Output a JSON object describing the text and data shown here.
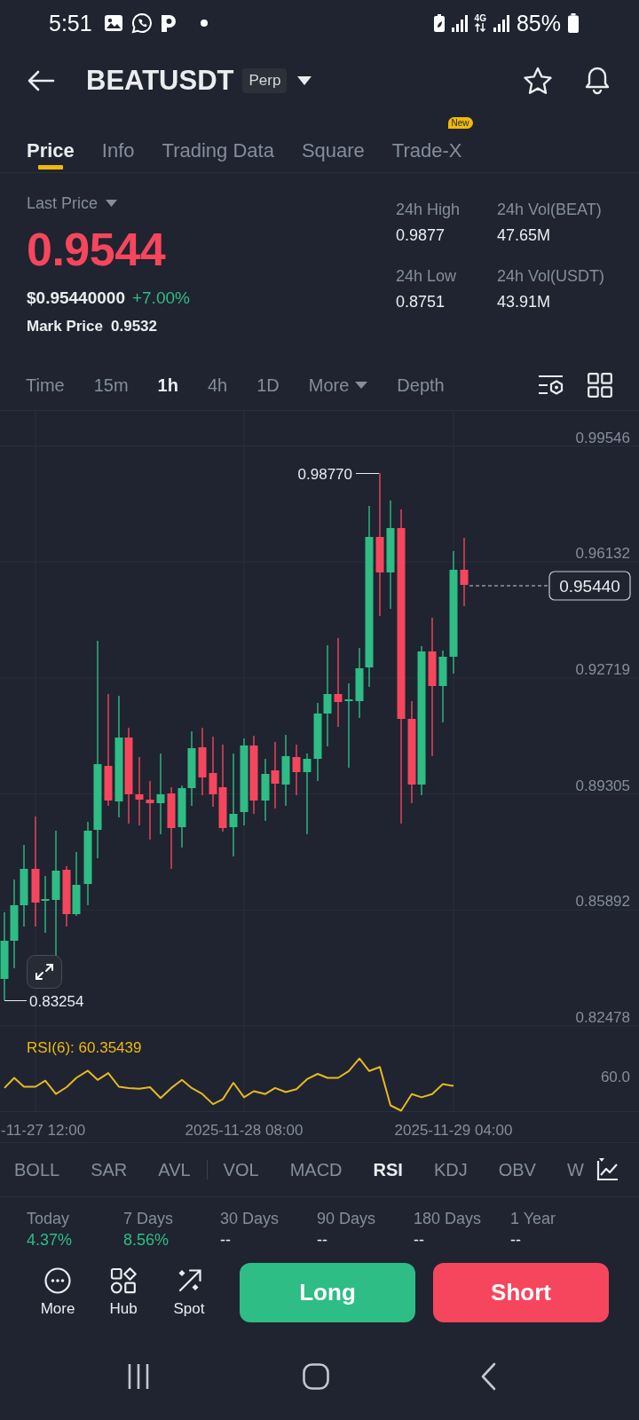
{
  "status_bar": {
    "time": "5:51",
    "network_type": "4G",
    "battery": "85%"
  },
  "header": {
    "symbol": "BEATUSDT",
    "contract_badge": "Perp"
  },
  "tabs": [
    {
      "label": "Price",
      "selected": true
    },
    {
      "label": "Info",
      "selected": false
    },
    {
      "label": "Trading Data",
      "selected": false
    },
    {
      "label": "Square",
      "selected": false
    },
    {
      "label": "Trade-X",
      "selected": false,
      "badge": "New"
    }
  ],
  "summary": {
    "price_type": "Last Price",
    "last_price": "0.9544",
    "price_down": true,
    "usd_price": "$0.95440000",
    "change": "+7.00%",
    "change_up": true,
    "mark_price_label": "Mark Price",
    "mark_price": "0.9532",
    "stats": [
      {
        "label": "24h High",
        "value": "0.9877"
      },
      {
        "label": "24h Vol(BEAT)",
        "value": "47.65M"
      },
      {
        "label": "24h Low",
        "value": "0.8751"
      },
      {
        "label": "24h Vol(USDT)",
        "value": "43.91M"
      }
    ]
  },
  "intervals": [
    {
      "label": "Time",
      "kind": "option",
      "selected": false
    },
    {
      "label": "15m",
      "kind": "option",
      "selected": false
    },
    {
      "label": "1h",
      "kind": "option",
      "selected": true
    },
    {
      "label": "4h",
      "kind": "option",
      "selected": false
    },
    {
      "label": "1D",
      "kind": "option",
      "selected": false
    },
    {
      "label": "More",
      "kind": "dropdown",
      "selected": false
    },
    {
      "label": "Depth",
      "kind": "option",
      "selected": false
    }
  ],
  "chart": {
    "price_labels": [
      "0.99546",
      "0.96132",
      "0.92719",
      "0.89305",
      "0.85892",
      "0.82478"
    ],
    "high_marker": "0.98770",
    "low_marker": "0.83254",
    "last_price_tag": "0.95440",
    "rsi_label": "RSI(6): 60.35439",
    "rsi_axis_label": "60.0",
    "time_labels": [
      "-11-27 12:00",
      "2025-11-28 08:00",
      "2025-11-29 04:00"
    ]
  },
  "indicators": {
    "main": [
      {
        "label": "BOLL",
        "selected": false
      },
      {
        "label": "SAR",
        "selected": false
      },
      {
        "label": "AVL",
        "selected": false
      }
    ],
    "sub": [
      {
        "label": "VOL",
        "selected": false
      },
      {
        "label": "MACD",
        "selected": false
      },
      {
        "label": "RSI",
        "selected": true
      },
      {
        "label": "KDJ",
        "selected": false
      },
      {
        "label": "OBV",
        "selected": false
      },
      {
        "label": "W",
        "selected": false
      }
    ]
  },
  "period_returns": [
    {
      "label": "Today",
      "value": "4.37%",
      "gain": true
    },
    {
      "label": "7 Days",
      "value": "8.56%",
      "gain": true
    },
    {
      "label": "30 Days",
      "value": "--",
      "gain": false
    },
    {
      "label": "90 Days",
      "value": "--",
      "gain": false
    },
    {
      "label": "180 Days",
      "value": "--",
      "gain": false
    },
    {
      "label": "1 Year",
      "value": "--",
      "gain": false
    }
  ],
  "shortcuts": [
    {
      "label": "More",
      "kind": "more"
    },
    {
      "label": "Hub",
      "kind": "hub"
    },
    {
      "label": "Spot",
      "kind": "spot"
    }
  ],
  "trade_buttons": [
    {
      "label": "Long",
      "kind": "long"
    },
    {
      "label": "Short",
      "kind": "short"
    }
  ]
}
